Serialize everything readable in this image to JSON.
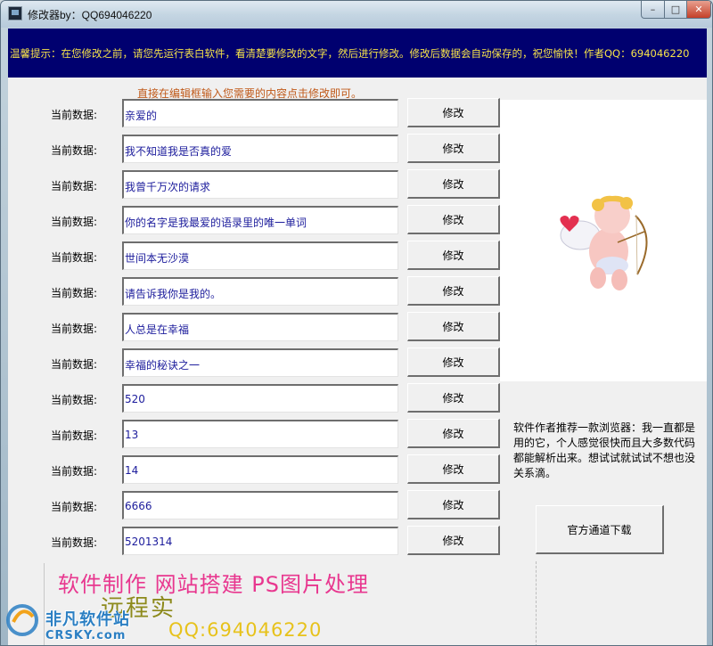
{
  "window": {
    "title": "修改器by：QQ694046220",
    "minimize": "–",
    "maximize": "□",
    "close": "✕"
  },
  "tip": "温馨提示：在您修改之前，请您先运行表白软件，看清楚要修改的文字，然后进行修改。修改后数据会自动保存的，祝您愉快！作者QQ：694046220",
  "hint": "直接在编辑框输入您需要的内容点击修改即可。",
  "rows": [
    {
      "label": "当前数据:",
      "value": "亲爱的",
      "button": "修改"
    },
    {
      "label": "当前数据:",
      "value": "我不知道我是否真的爱",
      "button": "修改"
    },
    {
      "label": "当前数据:",
      "value": "我曾千万次的请求",
      "button": "修改"
    },
    {
      "label": "当前数据:",
      "value": "你的名字是我最爱的语录里的唯一单词",
      "button": "修改"
    },
    {
      "label": "当前数据:",
      "value": "世间本无沙漠",
      "button": "修改"
    },
    {
      "label": "当前数据:",
      "value": "请告诉我你是我的。",
      "button": "修改"
    },
    {
      "label": "当前数据:",
      "value": "人总是在幸福",
      "button": "修改"
    },
    {
      "label": "当前数据:",
      "value": "幸福的秘诀之一",
      "button": "修改"
    },
    {
      "label": "当前数据:",
      "value": "520",
      "button": "修改"
    },
    {
      "label": "当前数据:",
      "value": "13",
      "button": "修改"
    },
    {
      "label": "当前数据:",
      "value": "14",
      "button": "修改"
    },
    {
      "label": "当前数据:",
      "value": "6666",
      "button": "修改"
    },
    {
      "label": "当前数据:",
      "value": "5201314",
      "button": "修改"
    }
  ],
  "recommend": "软件作者推荐一款浏览器：我一直都是用的它，个人感觉很快而且大多数代码都能解析出来。想试试就试试不想也没关系滴。",
  "download_button": "官方通道下载",
  "promo": {
    "line1": "软件制作  网站搭建 PS图片处理",
    "line2": "远程实",
    "qq": "QQ:694046220"
  },
  "watermark": {
    "line1": "非凡软件站",
    "line2": "CRSKY.com"
  },
  "colors": {
    "tipbar_bg": "#00006f",
    "tip_text": "#f5e24a",
    "field_text": "#1c1c9c",
    "promo_pink": "#e8378f"
  }
}
